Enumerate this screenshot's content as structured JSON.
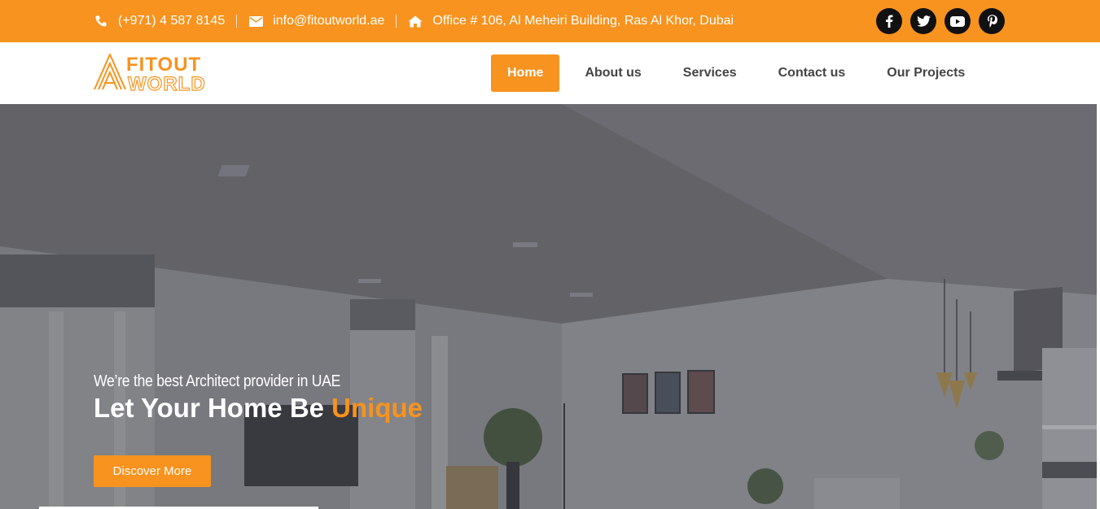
{
  "topbar": {
    "phone": "(+971) 4 587 8145",
    "email": "info@fitoutworld.ae",
    "address": "Office # 106, Al Meheiri Building, Ras Al Khor, Dubai",
    "icons": [
      "phone-icon",
      "envelope-icon",
      "home-icon"
    ],
    "social": [
      "facebook-icon",
      "twitter-icon",
      "youtube-icon",
      "pinterest-icon"
    ]
  },
  "logo": {
    "line1": "FITOUT",
    "line2": "WORLD"
  },
  "nav": {
    "items": [
      {
        "label": "Home",
        "active": true
      },
      {
        "label": "About us",
        "active": false
      },
      {
        "label": "Services",
        "active": false
      },
      {
        "label": "Contact us",
        "active": false
      },
      {
        "label": "Our Projects",
        "active": false
      }
    ]
  },
  "hero": {
    "tagline": "We’re the best Architect provider in UAE",
    "headline_main": "Let Your Home Be ",
    "headline_accent": "Unique",
    "cta_label": "Discover More"
  },
  "colors": {
    "accent": "#f7931e",
    "topbar_text": "#ffffff",
    "nav_text": "#444444",
    "social_bg": "#111111"
  }
}
